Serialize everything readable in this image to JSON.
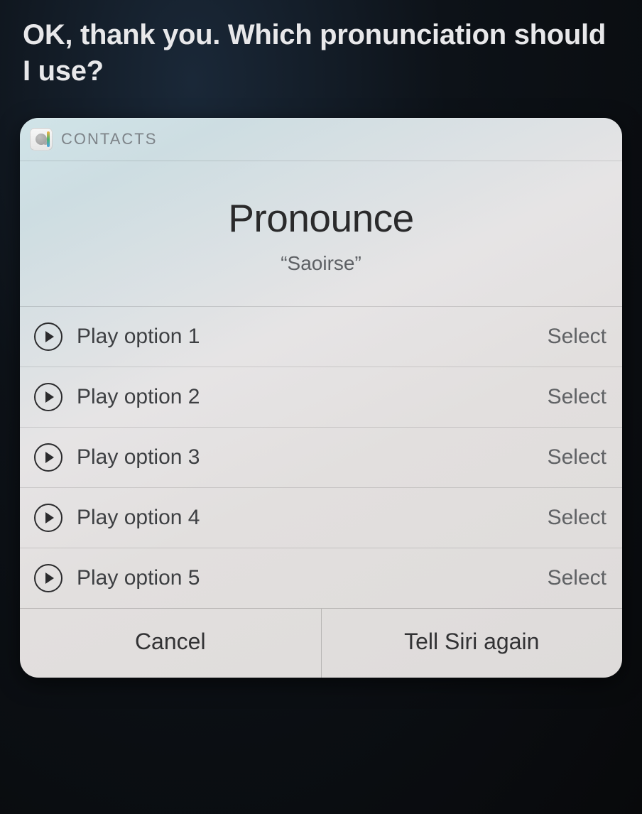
{
  "prompt": "OK, thank you. Which pronunciation should I use?",
  "card": {
    "app_label": "CONTACTS",
    "title": "Pronounce",
    "subtitle": "“Saoirse”",
    "options": [
      {
        "play_label": "Play option 1",
        "select_label": "Select"
      },
      {
        "play_label": "Play option 2",
        "select_label": "Select"
      },
      {
        "play_label": "Play option 3",
        "select_label": "Select"
      },
      {
        "play_label": "Play option 4",
        "select_label": "Select"
      },
      {
        "play_label": "Play option 5",
        "select_label": "Select"
      }
    ],
    "footer": {
      "cancel": "Cancel",
      "retry": "Tell Siri again"
    }
  }
}
